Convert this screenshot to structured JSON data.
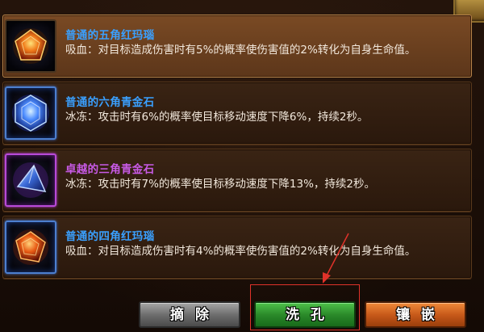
{
  "gems": [
    {
      "name": "普通的五角红玛瑙",
      "name_color": "#3aa0ff",
      "description": "吸血：对目标造成伤害时有5%的概率使伤害值的2%转化为自身生命值。",
      "icon": "red-agate-pentagon-icon",
      "selected": true
    },
    {
      "name": "普通的六角青金石",
      "name_color": "#3aa0ff",
      "description": "冰冻：攻击时有6%的概率使目标移动速度下降6%，持续2秒。",
      "icon": "blue-lapis-hexagon-icon",
      "selected": false
    },
    {
      "name": "卓越的三角青金石",
      "name_color": "#c85ae6",
      "description": "冰冻：攻击时有7%的概率使目标移动速度下降13%，持续2秒。",
      "icon": "blue-lapis-triangle-icon",
      "selected": false
    },
    {
      "name": "普通的四角红玛瑙",
      "name_color": "#3aa0ff",
      "description": "吸血：对目标造成伤害时有4%的概率使伤害值的2%转化为自身生命值。",
      "icon": "red-agate-square-icon",
      "selected": false
    }
  ],
  "buttons": {
    "remove": "摘除",
    "wash": "洗孔",
    "inlay": "镶嵌"
  },
  "colors": {
    "annotation": "#e0322a"
  }
}
